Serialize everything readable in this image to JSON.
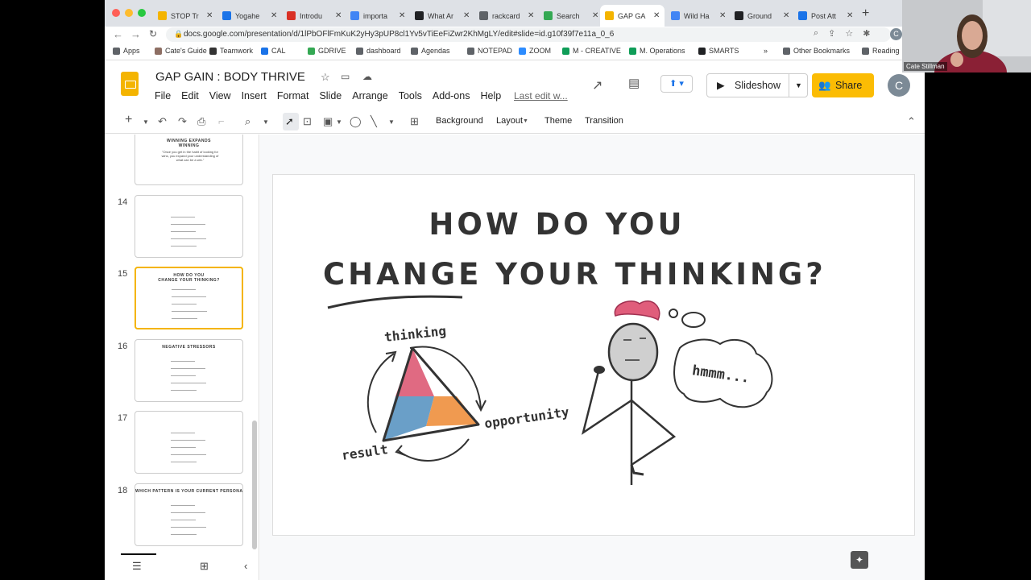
{
  "browser": {
    "tabs": [
      {
        "label": "STOP Tr",
        "color": "#f4b400"
      },
      {
        "label": "Yogahe",
        "color": "#1a73e8"
      },
      {
        "label": "Introdu",
        "color": "#d93025"
      },
      {
        "label": "importa",
        "color": "#4285f4"
      },
      {
        "label": "What Ar",
        "color": "#202124"
      },
      {
        "label": "rackcard",
        "color": "#5f6368"
      },
      {
        "label": "Search",
        "color": "#34a853"
      },
      {
        "label": "GAP GA",
        "color": "#f4b400"
      },
      {
        "label": "Wild Ha",
        "color": "#4285f4"
      },
      {
        "label": "Ground",
        "color": "#202124"
      },
      {
        "label": "Post Att",
        "color": "#1a73e8"
      }
    ],
    "new_tab": "+",
    "url": "docs.google.com/presentation/d/1lPbOFlFmKuK2yHy3pUP8cl1Yv5vTiEeFiZwr2KhMgLY/edit#slide=id.g10f39f7e11a_0_6",
    "avatar_letter": "C"
  },
  "bookmarks": [
    {
      "label": "Apps",
      "color": "#5f6368"
    },
    {
      "label": "Cate's Guide",
      "color": "#8d6e63"
    },
    {
      "label": "Teamwork",
      "color": "#333333"
    },
    {
      "label": "CAL",
      "color": "#1a73e8"
    },
    {
      "label": "GDRIVE",
      "color": "#34a853"
    },
    {
      "label": "dashboard",
      "color": "#5f6368"
    },
    {
      "label": "Agendas",
      "color": "#5f6368"
    },
    {
      "label": "NOTEPAD",
      "color": "#5f6368"
    },
    {
      "label": "ZOOM",
      "color": "#2d8cff"
    },
    {
      "label": "M - CREATIVE",
      "color": "#0f9d58"
    },
    {
      "label": "M. Operations",
      "color": "#0f9d58"
    },
    {
      "label": "SMARTS",
      "color": "#202124"
    },
    {
      "label": "»",
      "color": "#ffffff"
    },
    {
      "label": "Other Bookmarks",
      "color": "#5f6368"
    },
    {
      "label": "Reading",
      "color": "#5f6368"
    }
  ],
  "docs": {
    "title": "GAP GAIN : BODY THRIVE",
    "menus": [
      "File",
      "Edit",
      "View",
      "Insert",
      "Format",
      "Slide",
      "Arrange",
      "Tools",
      "Add-ons",
      "Help"
    ],
    "last_edit": "Last edit w...",
    "slideshow_label": "Slideshow",
    "share_label": "Share",
    "user_letter": "C"
  },
  "toolbar": {
    "background": "Background",
    "layout": "Layout",
    "theme": "Theme",
    "transition": "Transition"
  },
  "filmstrip": {
    "top_thumb_title": "WINNING EXPANDS\nWINNING",
    "top_thumb_quote": "\"Once you get in the habit of looking for wins, you expand your understanding of what can be a win.\"",
    "slides": [
      {
        "number": "14",
        "title": ""
      },
      {
        "number": "15",
        "title": "HOW DO YOU\nCHANGE YOUR THINKING?"
      },
      {
        "number": "16",
        "title": "NEGATIVE STRESSORS"
      },
      {
        "number": "17",
        "title": ""
      },
      {
        "number": "18",
        "title": "WHICH PATTERN IS YOUR CURRENT PERSONALITY?"
      }
    ],
    "selected": "15"
  },
  "slide": {
    "title_line1": "HOW DO YOU",
    "title_line2": "CHANGE YOUR THINKING?",
    "label_thinking": "thinking",
    "label_opportunity": "opportunity",
    "label_result": "result",
    "thought": "hmmm...",
    "triangle_colors": [
      "#e06a82",
      "#f09a50",
      "#6a9fc8"
    ]
  },
  "webcam": {
    "name": "Cate Stillman"
  }
}
